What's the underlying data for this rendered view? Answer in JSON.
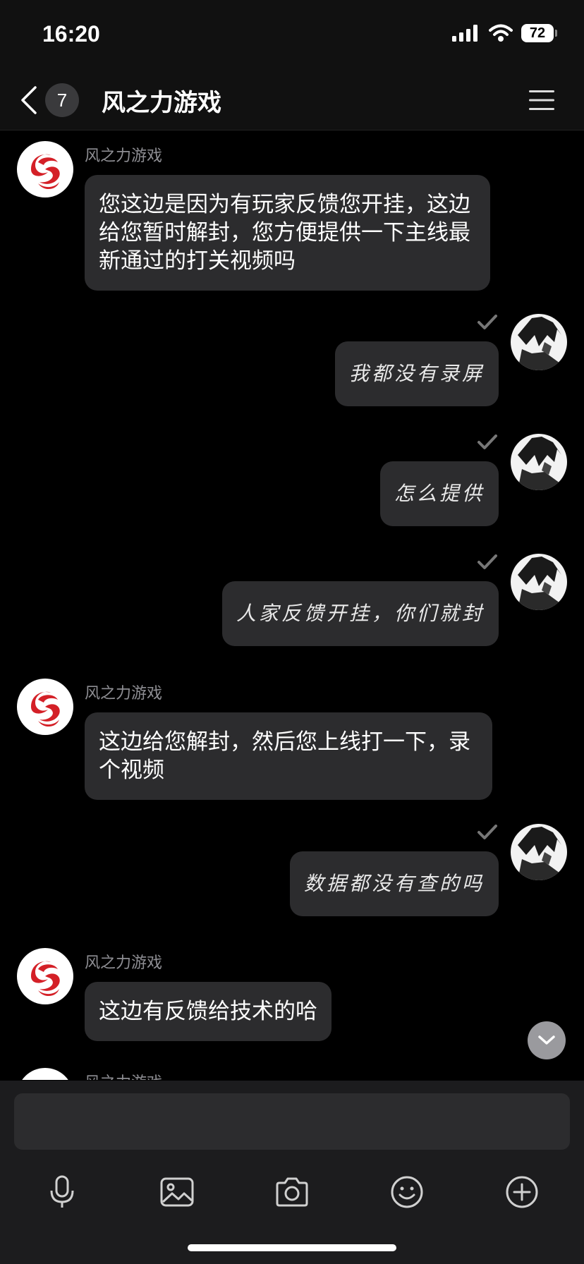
{
  "status_bar": {
    "time": "16:20",
    "battery": "72"
  },
  "header": {
    "unread_count": "7",
    "title": "风之力游戏"
  },
  "messages": [
    {
      "direction": "in",
      "sender": "风之力游戏",
      "text": "您这边是因为有玩家反馈您开挂，这边给您暂时解封，您方便提供一下主线最新通过的打关视频吗"
    },
    {
      "direction": "out",
      "text": "我都没有录屏"
    },
    {
      "direction": "out",
      "text": "怎么提供"
    },
    {
      "direction": "out",
      "text": "人家反馈开挂，你们就封"
    },
    {
      "direction": "in",
      "sender": "风之力游戏",
      "text": "这边给您解封，然后您上线打一下，录个视频"
    },
    {
      "direction": "out",
      "text": "数据都没有查的吗"
    },
    {
      "direction": "in",
      "sender": "风之力游戏",
      "text": "这边有反馈给技术的哈"
    },
    {
      "direction": "in",
      "sender": "风之力游戏",
      "text": ""
    }
  ],
  "input": {
    "placeholder": "",
    "value": ""
  },
  "toolbar": [
    "microphone-icon",
    "image-icon",
    "camera-icon",
    "emoji-icon",
    "plus-icon"
  ],
  "colors": {
    "background": "#000000",
    "bar": "#111111",
    "bubble": "#2c2c2e",
    "brand_red": "#d42027",
    "secondary_text": "#8e8e93"
  }
}
